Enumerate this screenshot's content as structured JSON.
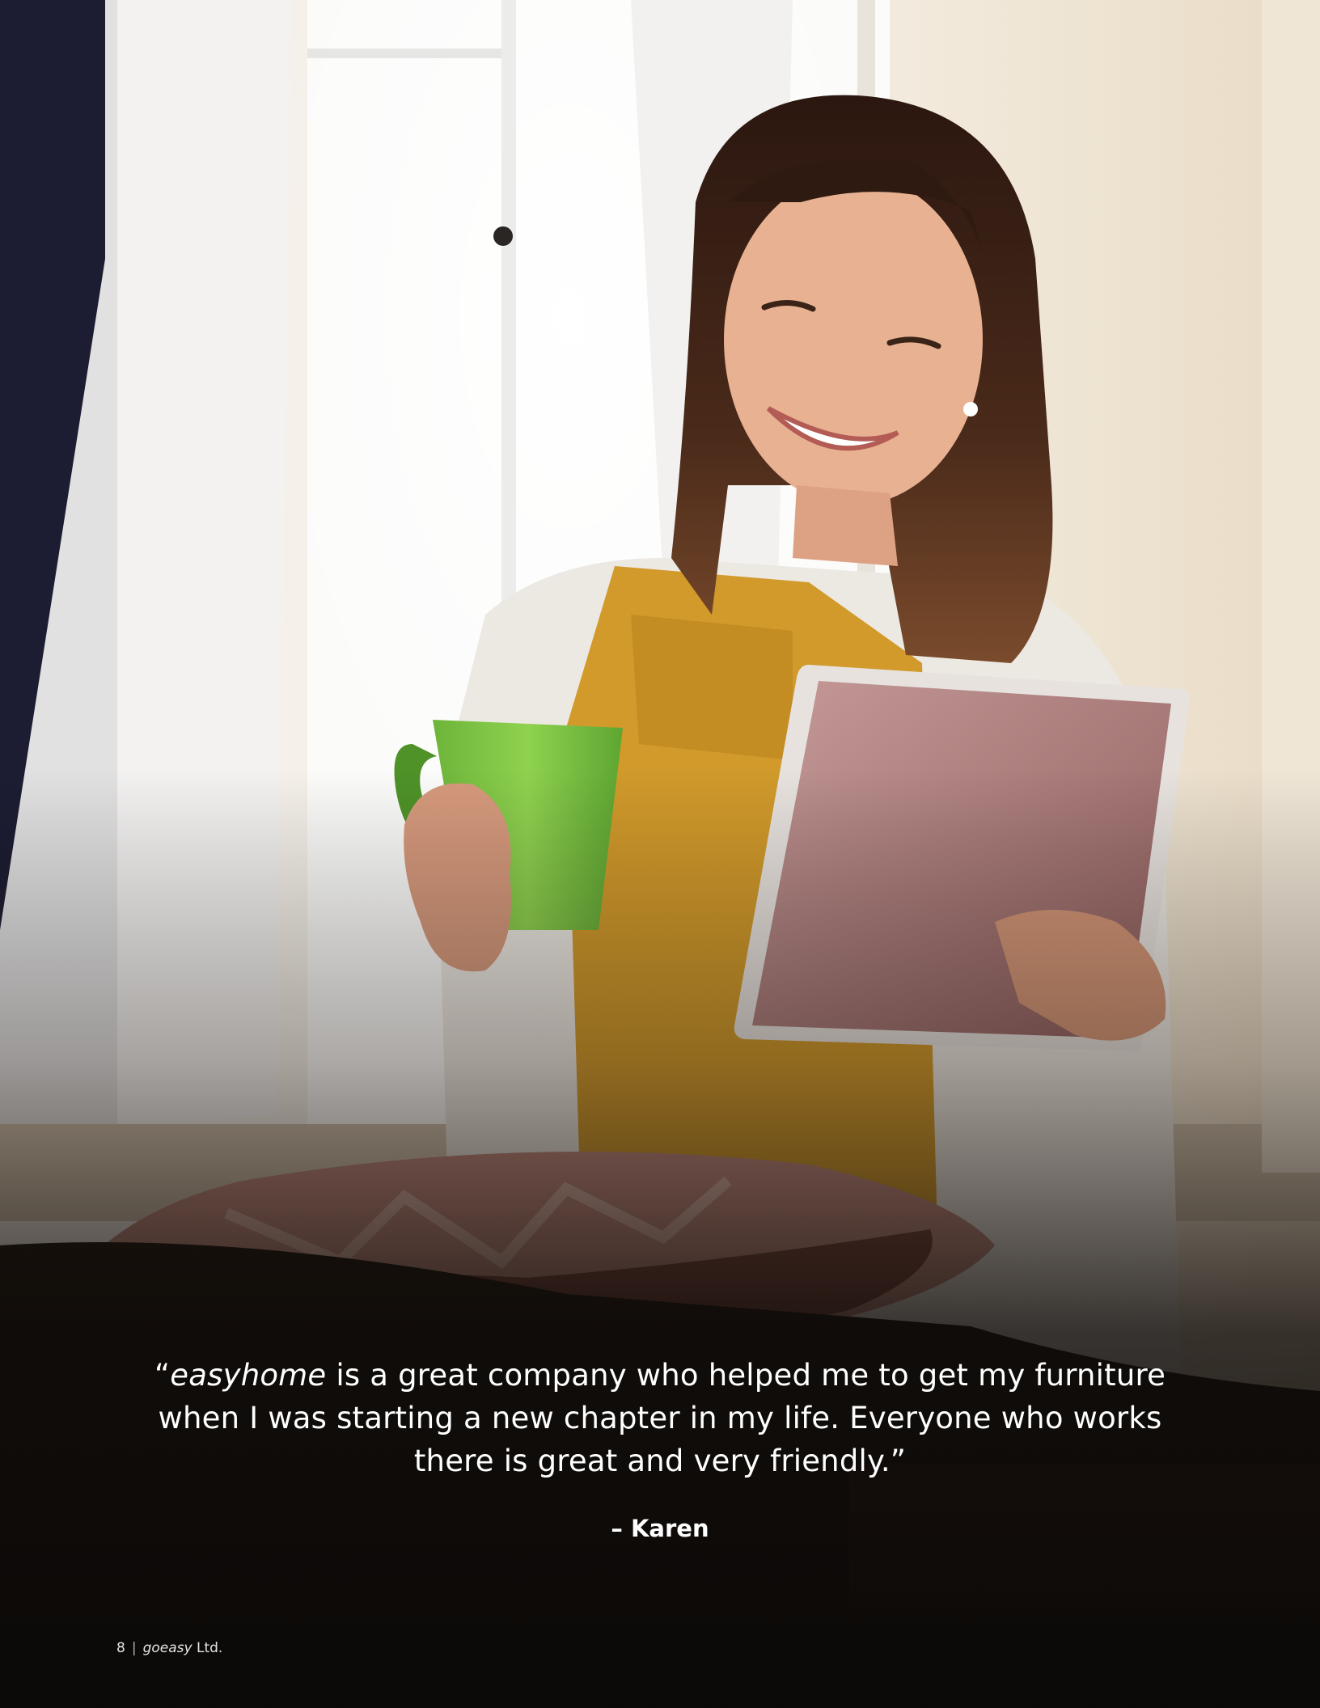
{
  "photo": {
    "alt": "Smiling woman holding a green mug and a tablet, seated with a patterned pillow by a bright window"
  },
  "quote": {
    "open_mark": "“",
    "brand": "easyhome",
    "line1_rest": " is a great company who helped me to get my furniture",
    "line2": "when I was starting a new chapter in my life. Everyone who works",
    "line3": "there is great and very friendly.”",
    "attribution": "– Karen"
  },
  "footer": {
    "page_number": "8",
    "separator": "|",
    "company_italic": "goeasy",
    "company_suffix": " Ltd."
  },
  "colors": {
    "text": "#ffffff",
    "mug": "#7cc242",
    "top": "#f3b23a"
  }
}
